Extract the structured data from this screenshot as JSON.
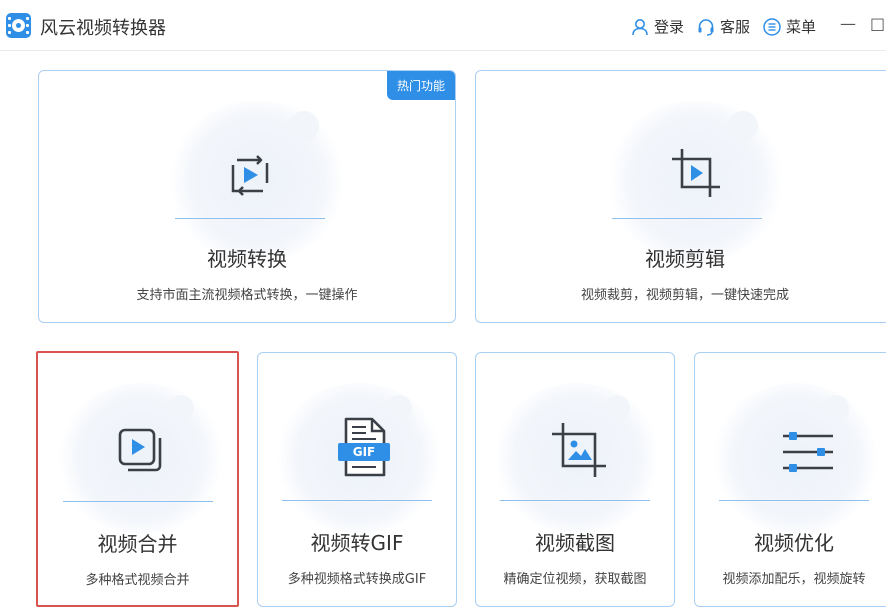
{
  "app": {
    "title": "风云视频转换器"
  },
  "toolbar": {
    "login_label": "登录",
    "service_label": "客服",
    "menu_label": "菜单",
    "minimize_label": "—",
    "maximize_label": "□"
  },
  "cards": [
    {
      "title": "视频转换",
      "desc": "支持市面主流视频格式转换，一键操作",
      "icon": "video-convert-icon",
      "badge": "热门功能"
    },
    {
      "title": "视频剪辑",
      "desc": "视频裁剪，视频剪辑，一键快速完成",
      "icon": "video-crop-icon"
    },
    {
      "title": "视频合并",
      "desc": "多种格式视频合并",
      "icon": "video-merge-icon",
      "selected": true
    },
    {
      "title": "视频转GIF",
      "desc": "多种视频格式转换成GIF",
      "icon": "gif-file-icon",
      "icon_text": "GIF"
    },
    {
      "title": "视频截图",
      "desc": "精确定位视频，获取截图",
      "icon": "screenshot-crop-icon"
    },
    {
      "title": "视频优化",
      "desc": "视频添加配乐，视频旋转",
      "icon": "sliders-icon"
    }
  ],
  "colors": {
    "accent": "#2f8fe6",
    "card_border": "#a9cff3",
    "selected_border": "#d9534f",
    "icon_dark": "#3b4048"
  }
}
